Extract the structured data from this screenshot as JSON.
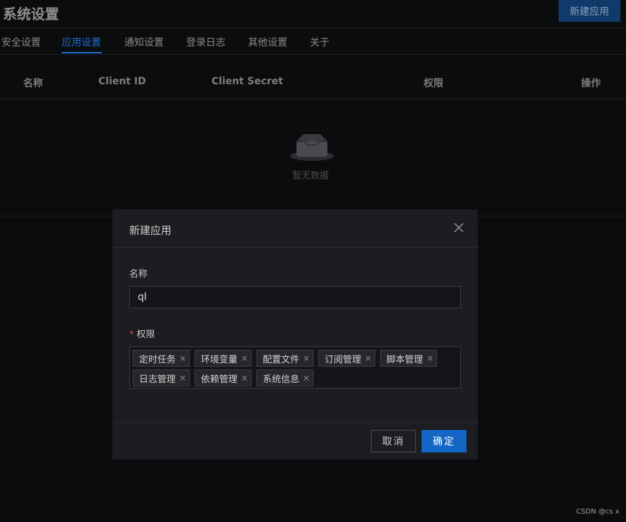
{
  "header": {
    "title": "系统设置",
    "new_app_label": "新建应用"
  },
  "tabs": [
    {
      "label": "安全设置"
    },
    {
      "label": "应用设置"
    },
    {
      "label": "通知设置"
    },
    {
      "label": "登录日志"
    },
    {
      "label": "其他设置"
    },
    {
      "label": "关于"
    }
  ],
  "active_tab": "应用设置",
  "table": {
    "columns": [
      "名称",
      "Client ID",
      "Client Secret",
      "权限",
      "操作"
    ],
    "empty_text": "暂无数据"
  },
  "modal": {
    "title": "新建应用",
    "name_label": "名称",
    "name_value": "ql",
    "required_mark": "*",
    "permission_label": "权限",
    "permissions": [
      "定时任务",
      "环境变量",
      "配置文件",
      "订阅管理",
      "脚本管理",
      "日志管理",
      "依赖管理",
      "系统信息"
    ],
    "tag_close_glyph": "×",
    "cancel_label": "取消",
    "ok_label": "确定"
  },
  "watermark": "CSDN @cs x",
  "colors": {
    "accent": "#1466c6",
    "background": "#0b0c0e",
    "modal_background": "#1c1d20"
  },
  "icons": {
    "close": "close-icon",
    "empty": "empty-box-icon"
  }
}
